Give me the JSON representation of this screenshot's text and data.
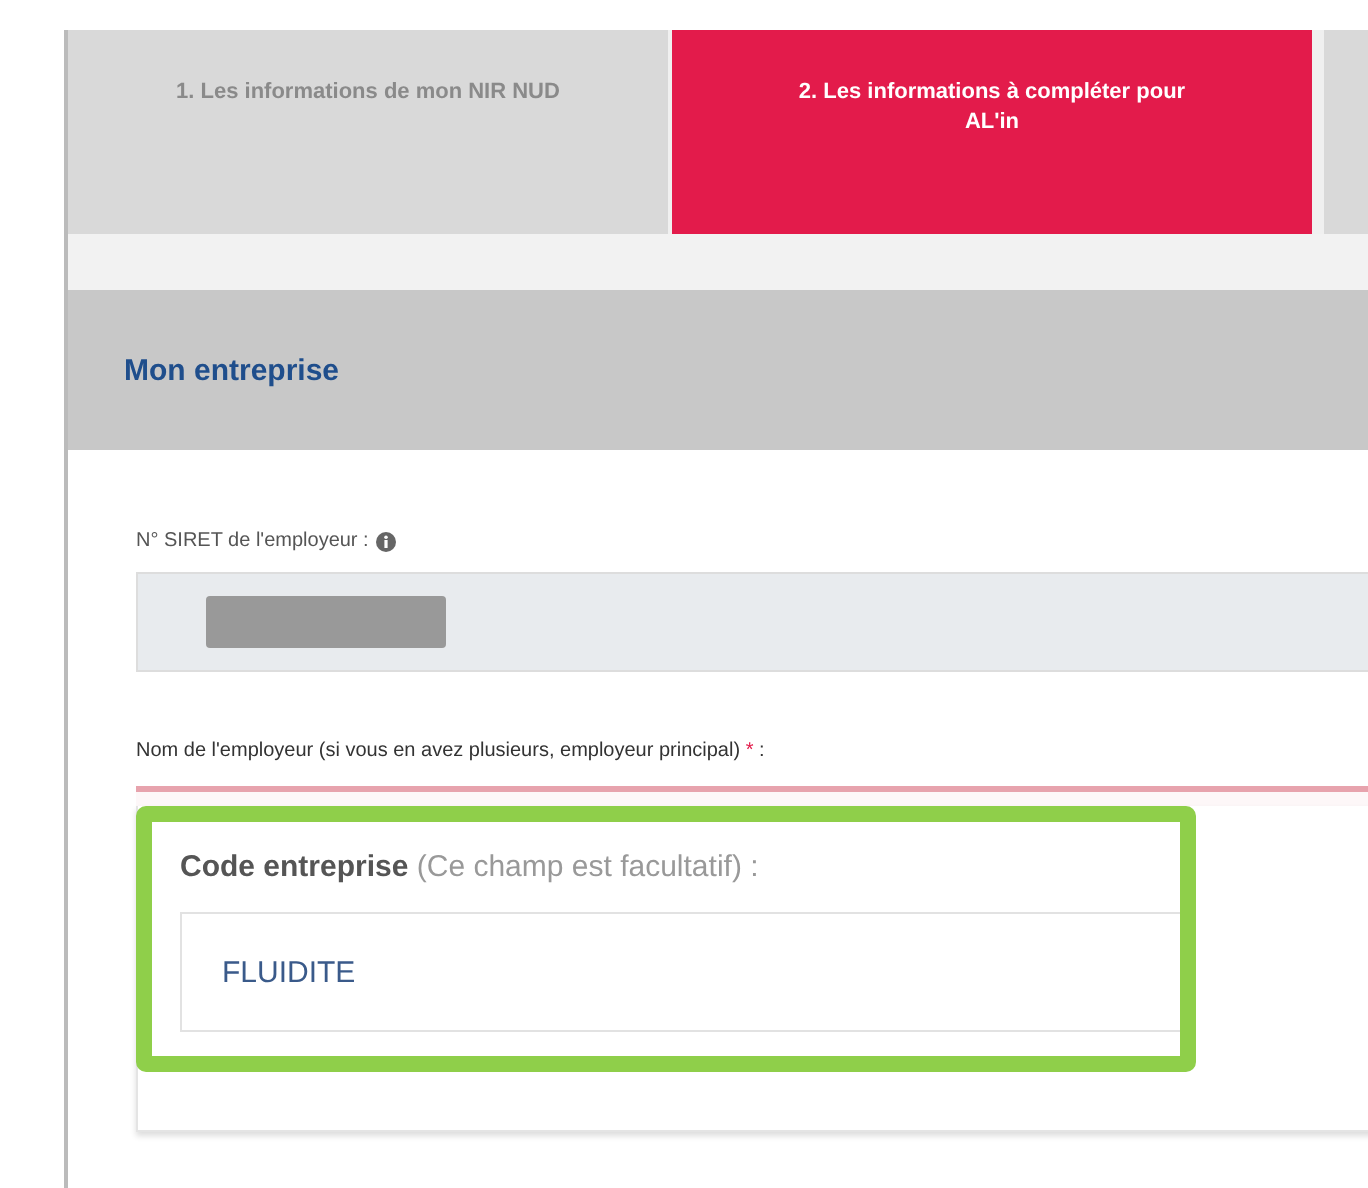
{
  "tabs": [
    {
      "label": "1. Les informations de mon NIR NUD",
      "selected": false
    },
    {
      "label": "2. Les informations à compléter pour AL'in",
      "selected": true
    }
  ],
  "section": {
    "title": "Mon entreprise"
  },
  "siret": {
    "label": "N° SIRET de l'employeur :"
  },
  "employer": {
    "label": "Nom de l'employeur (si vous en avez plusieurs, employeur principal)",
    "required_mark": "*",
    "suffix": " :"
  },
  "highlight": {
    "label": "Code entreprise",
    "hint": "(Ce champ est facultatif) :",
    "value": "FLUIDITE"
  }
}
